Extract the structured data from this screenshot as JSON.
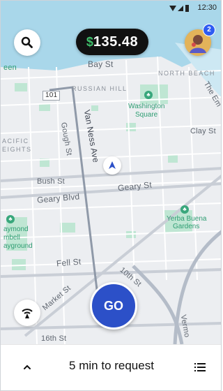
{
  "status_bar": {
    "time": "12:30"
  },
  "header": {
    "currency_symbol": "$",
    "earnings": "135.48",
    "notification_count": "2"
  },
  "map": {
    "districts": {
      "north_beach": "NORTH BEACH",
      "russian_hill": "RUSSIAN HILL",
      "pacific_heights_1": "ACIFIC",
      "pacific_heights_2": "EIGHTS"
    },
    "streets": {
      "bay": "Bay St",
      "hwy": "101",
      "van_ness": "Van Ness Ave",
      "gough": "Gough St",
      "clay": "Clay St",
      "bush": "Bush St",
      "geary_st": "Geary St",
      "geary_blvd": "Geary Blvd",
      "fell": "Fell St",
      "tenth": "10th St",
      "market": "Market St",
      "sixteenth": "16th St",
      "embarcadero": "The Em",
      "vermont": "Vermo",
      "een": "een"
    },
    "pois": {
      "washington_1": "Washington",
      "washington_2": "Square",
      "yerba_1": "Yerba Buena",
      "yerba_2": "Gardens",
      "raymond_1": "aymond",
      "raymond_2": "mbell",
      "raymond_3": "ayground"
    }
  },
  "go_button": {
    "label": "GO"
  },
  "bottom_sheet": {
    "status": "5 min to request"
  },
  "colors": {
    "go": "#2c50c8",
    "badge": "#2e5cf2",
    "earnings_bg": "#111111",
    "dollar": "#3fbf6b",
    "park": "#bfe6d3"
  }
}
